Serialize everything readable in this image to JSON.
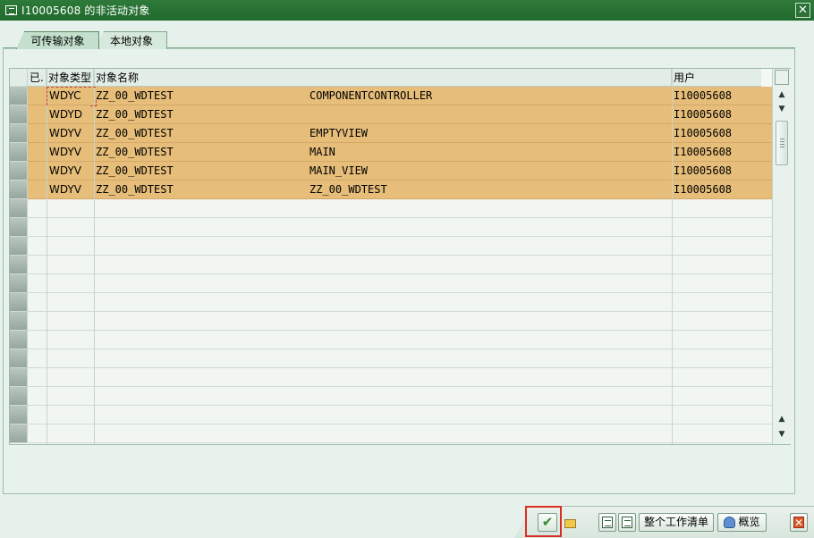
{
  "window": {
    "title": "I10005608 的非活动对象",
    "close_glyph": "✕"
  },
  "tabs": [
    {
      "label": "可传输对象",
      "active": true
    },
    {
      "label": "本地对象",
      "active": false
    }
  ],
  "table": {
    "headers": {
      "done": "已.",
      "object_type": "对象类型",
      "object_name": "对象名称",
      "user": "用户"
    },
    "rows": [
      {
        "type": "WDYC",
        "name": "ZZ_00_WDTEST",
        "sub": "COMPONENTCONTROLLER",
        "user": "I10005608"
      },
      {
        "type": "WDYD",
        "name": "ZZ_00_WDTEST",
        "sub": "",
        "user": "I10005608"
      },
      {
        "type": "WDYV",
        "name": "ZZ_00_WDTEST",
        "sub": "EMPTYVIEW",
        "user": "I10005608"
      },
      {
        "type": "WDYV",
        "name": "ZZ_00_WDTEST",
        "sub": "MAIN",
        "user": "I10005608"
      },
      {
        "type": "WDYV",
        "name": "ZZ_00_WDTEST",
        "sub": "MAIN_VIEW",
        "user": "I10005608"
      },
      {
        "type": "WDYV",
        "name": "ZZ_00_WDTEST",
        "sub": " ZZ_00_WDTEST",
        "user": "I10005608"
      }
    ],
    "row_highlight_color": "#e6bd79"
  },
  "toolbar": {
    "ok_icon": "checkmark-icon",
    "whole_worklist_label": "整个工作清单",
    "overview_label": "概览",
    "cancel_icon": "cancel-icon"
  }
}
